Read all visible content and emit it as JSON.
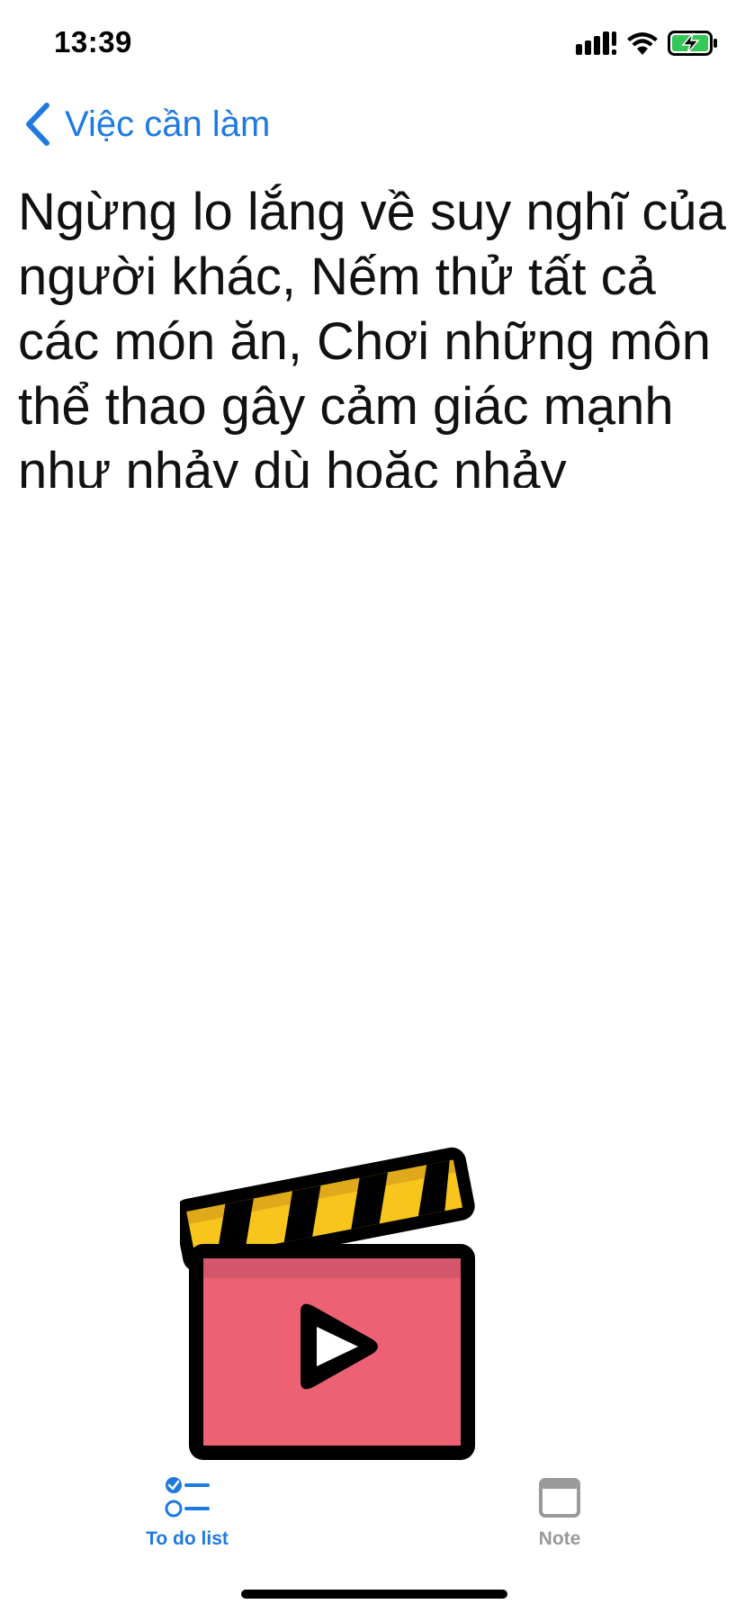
{
  "status_bar": {
    "time": "13:39",
    "icons": [
      "cellular-signal-icon",
      "wifi-icon",
      "battery-charging-icon"
    ]
  },
  "nav": {
    "back_label": "Việc cần làm",
    "back_icon": "chevron-left-icon"
  },
  "content": {
    "text": "Ngừng lo lắng về suy nghĩ của người khác, Nếm thử tất cả các món ăn, Chơi những môn thể thao gây cảm giác mạnh như nhảy dù hoặc nhảy"
  },
  "illustration": {
    "icon": "film-clapperboard-icon",
    "colors": {
      "clapper_top": "#f7c51c",
      "clapper_body": "#ec6274",
      "outline": "#000000"
    }
  },
  "tab_bar": {
    "tabs": [
      {
        "label": "To do list",
        "icon": "checklist-icon",
        "active": true
      },
      {
        "label": "Note",
        "icon": "window-icon",
        "active": false
      }
    ]
  },
  "colors": {
    "accent": "#1f7ae0",
    "inactive": "#9a9a9a",
    "text": "#111111"
  }
}
